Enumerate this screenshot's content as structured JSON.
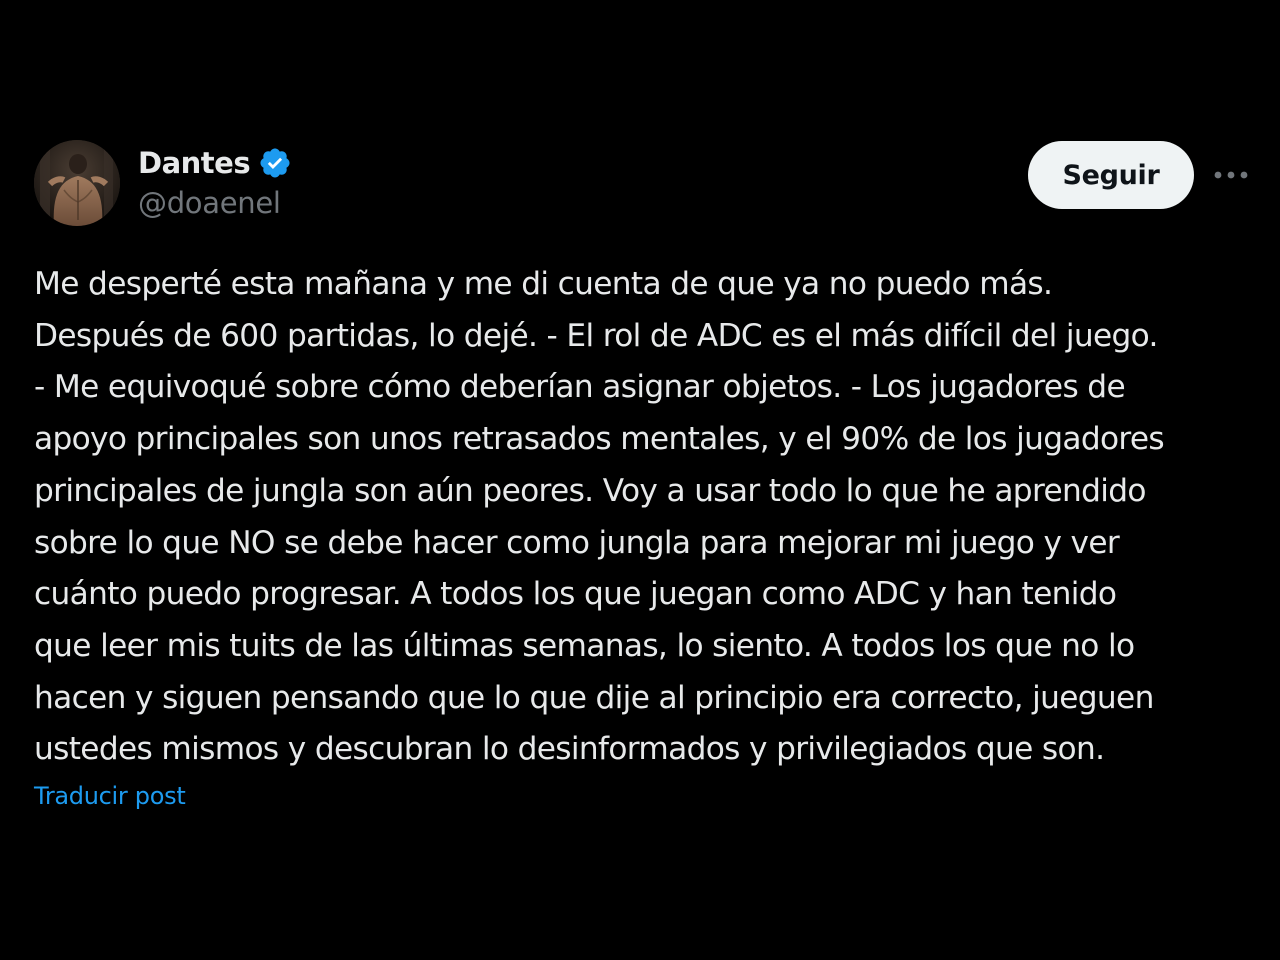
{
  "author": {
    "display_name": "Dantes",
    "handle": "@doaenel",
    "verified": true,
    "verified_color": "#1d9bf0"
  },
  "actions": {
    "follow_label": "Seguir",
    "more_icon": "ellipsis-horizontal-icon"
  },
  "tweet": {
    "lines": [
      "Me desperté esta mañana y me di cuenta de que ya no puedo más.",
      "Después de 600 partidas, lo dejé. - El rol de ADC es el más difícil del juego.",
      "- Me equivoqué sobre cómo deberían asignar objetos. - Los jugadores de",
      "apoyo principales son unos retrasados mentales, y el 90% de los jugadores",
      "principales de jungla son aún peores. Voy a usar todo lo que he aprendido",
      "sobre lo que NO se debe hacer como jungla para mejorar mi juego y ver",
      "cuánto puedo progresar. A todos los que juegan como ADC y han tenido",
      "que leer mis tuits de las últimas semanas, lo siento. A todos los que no lo",
      "hacen y siguen pensando que lo que dije al principio era correcto, jueguen",
      "ustedes mismos y descubran lo desinformados y privilegiados que son."
    ],
    "translate_label": "Traducir post"
  },
  "colors": {
    "background": "#000000",
    "text_primary": "#e7e9ea",
    "text_secondary": "#71767b",
    "link": "#1d9bf0",
    "follow_button_bg": "#eff3f4",
    "follow_button_text": "#0f1419"
  }
}
